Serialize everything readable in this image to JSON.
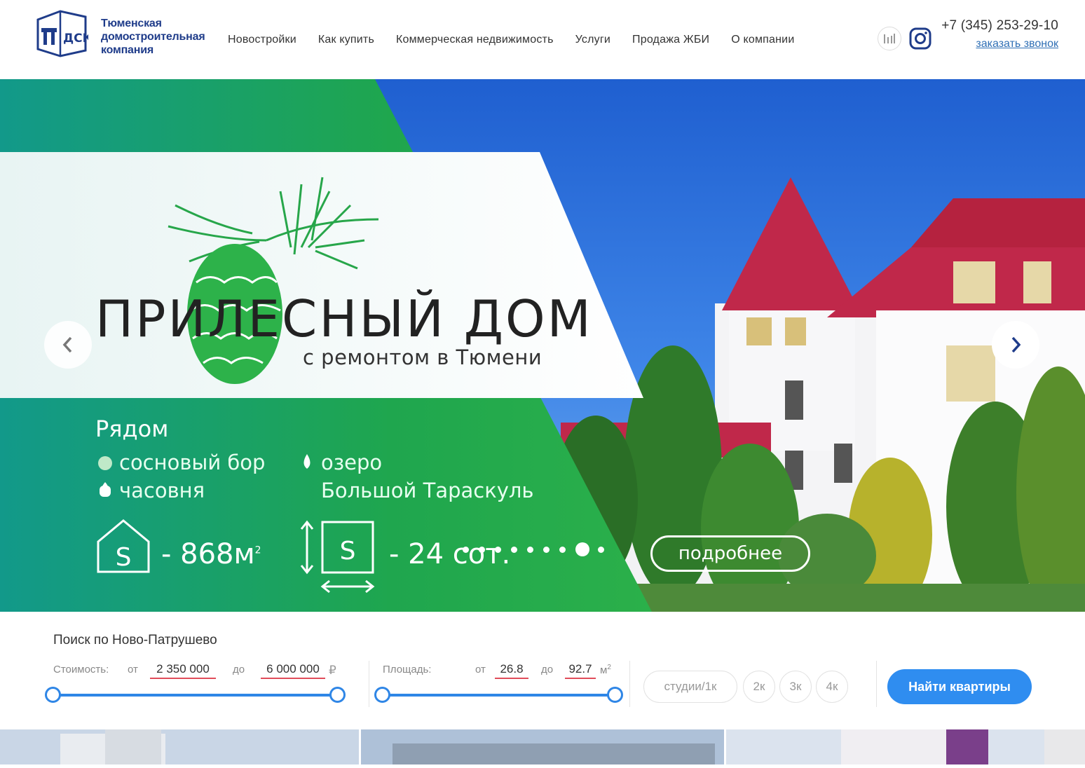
{
  "header": {
    "logo_text": [
      "Тюменская",
      "домостроительная",
      "компания"
    ],
    "logo_mark_text": "ДСК",
    "nav": [
      "Новостройки",
      "Как купить",
      "Коммерческая недвижимость",
      "Услуги",
      "Продажа ЖБИ",
      "О компании"
    ],
    "phone": "+7 (345) 253-29-10",
    "callback": "заказать звонок",
    "icons": [
      "stats-icon",
      "instagram-icon"
    ]
  },
  "hero": {
    "title": "ПРИЛЕСНЫЙ ДОМ",
    "subtitle": "с ремонтом в Тюмени",
    "near_title": "Рядом",
    "near_items": [
      "сосновый бор",
      "часовня",
      "озеро",
      "Большой Тараскуль"
    ],
    "house_area": "- 868м",
    "house_area_sup": "2",
    "plot_area": "- 24 сот.",
    "area_icon_letter": "S",
    "more_button": "подробнее",
    "slide_count": 9,
    "active_slide": 8,
    "colors": {
      "green": "#22a84a",
      "teal": "#129a86",
      "roof": "#c0284a",
      "sky": "#2a6fd6"
    }
  },
  "search": {
    "title": "Поиск по Ново-Патрушево",
    "price_label": "Стоимость:",
    "from": "от",
    "to": "до",
    "price_from": "2 350 000",
    "price_to": "6 000 000",
    "currency": "₽",
    "area_label": "Площадь:",
    "area_from": "26.8",
    "area_to": "92.7",
    "area_unit": "м",
    "area_unit_sup": "2",
    "rooms": [
      "студии/1к",
      "2к",
      "3к",
      "4к"
    ],
    "find_button": "Найти квартиры",
    "accent": "#2f8df0"
  }
}
